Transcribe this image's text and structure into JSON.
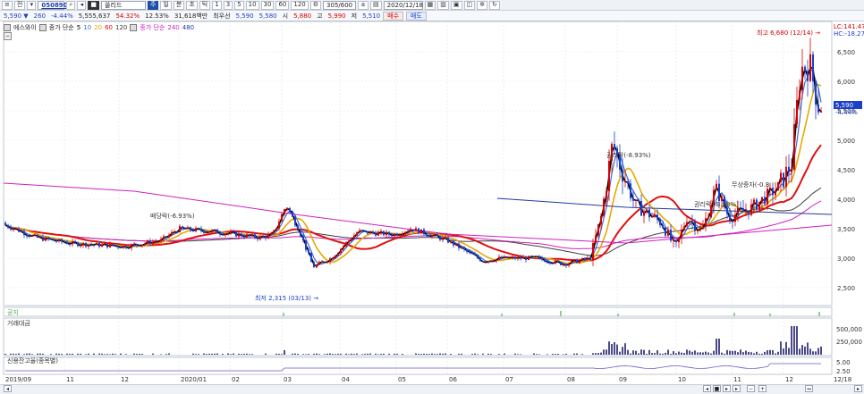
{
  "toolbar": {
    "combo_label": "전",
    "symbol_code": "050890",
    "stock_name": "쏠리드",
    "buttons": [
      "주",
      "일",
      "분",
      "초",
      "틱"
    ],
    "periods": [
      "1",
      "3",
      "5",
      "10",
      "30",
      "60",
      "120"
    ],
    "count": "305/600",
    "date": "2020/12/18"
  },
  "info": {
    "price": "5,590 ▼",
    "change": "260",
    "change_pct": "-4.44%",
    "volume": "5,555,637",
    "vol_ratio": "54.32%",
    "turnover": "12.53%",
    "amount": "31,618백만",
    "prior_label": "최우선",
    "prior_ask": "5,590",
    "prior_bid": "5,580",
    "open_label": "시",
    "open": "5,880",
    "high_label": "고",
    "high": "5,990",
    "low_label": "저",
    "low": "5,510",
    "buy_label": "매수",
    "sell_label": "매도"
  },
  "legend": {
    "name": "에스와이",
    "ma_label": "종가 단순",
    "ma_values": [
      "5",
      "10",
      "20",
      "60",
      "120"
    ],
    "ma2_label": "종가 단순",
    "ma2_values": [
      "240",
      "480"
    ]
  },
  "annotations": {
    "high_note": "최고 6,680 (12/14) →",
    "low_note": "최저 2,315 (03/13) →",
    "dividend1": "배당락(-6.93%)",
    "dividend2": "권리락(-8.93%)",
    "dividend3": "권리락(-B.83%)",
    "capital": "무상증자(-0.8",
    "lc": "LC:141.47",
    "hc": "HC:-18.27",
    "last_price": "5,590",
    "last_pct": "-4.44%"
  },
  "yaxis": [
    "6,500",
    "6,000",
    "5,500",
    "5,000",
    "4,500",
    "4,000",
    "3,500",
    "3,000",
    "2,500"
  ],
  "xaxis": [
    "2019/09",
    "11",
    "12",
    "2020/01",
    "02",
    "03",
    "04",
    "05",
    "06",
    "07",
    "08",
    "09",
    "10",
    "11",
    "12",
    "12/18"
  ],
  "panels": {
    "volume_label": "거래대금",
    "volume_ticks": [
      "500,000",
      "250,000"
    ],
    "credit_label": "신용잔고율(종목별)",
    "credit_ticks": [
      "5.00",
      "2.50"
    ],
    "small_label": "공지"
  },
  "colors": {
    "up": "#d40000",
    "down": "#1b3fc8",
    "ma5": "#000000",
    "ma10": "#3a6fd8",
    "ma20": "#e8a800",
    "ma60": "#e01010",
    "ma120": "#404040",
    "ma240": "#d020c0",
    "ma480": "#1e3aa0"
  }
}
